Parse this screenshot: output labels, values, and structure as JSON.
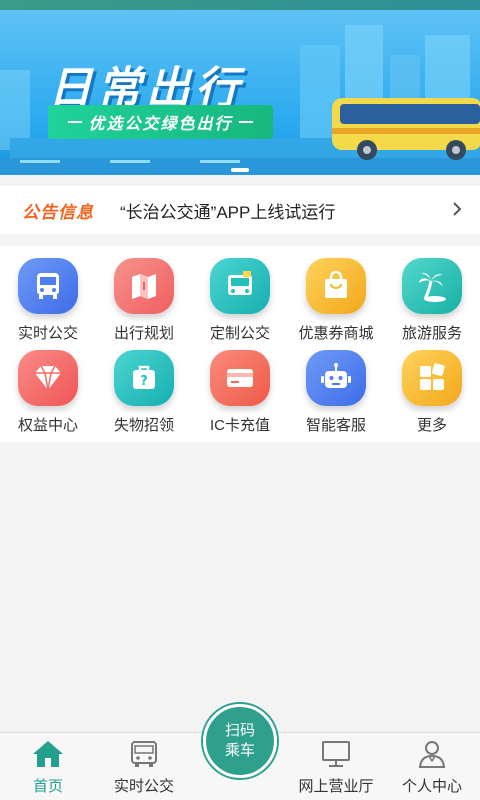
{
  "banner": {
    "title": "日常出行",
    "subtitle": "优选公交绿色出行"
  },
  "notice": {
    "tag": "公告信息",
    "text": "“长治公交通”APP上线试运行"
  },
  "services": [
    {
      "label": "实时公交",
      "icon": "bus-icon",
      "color": "#4f7ef2"
    },
    {
      "label": "出行规划",
      "icon": "map-icon",
      "color": "#f0706a"
    },
    {
      "label": "定制公交",
      "icon": "custom-bus-icon",
      "color": "#22c1bd"
    },
    {
      "label": "优惠券商城",
      "icon": "shopping-bag-icon",
      "color": "#f5b728"
    },
    {
      "label": "旅游服务",
      "icon": "palm-tree-icon",
      "color": "#2cc6b9"
    },
    {
      "label": "权益中心",
      "icon": "diamond-icon",
      "color": "#f36a6a"
    },
    {
      "label": "失物招领",
      "icon": "luggage-icon",
      "color": "#22c1bd"
    },
    {
      "label": "IC卡充值",
      "icon": "card-icon",
      "color": "#f36a5a"
    },
    {
      "label": "智能客服",
      "icon": "robot-icon",
      "color": "#4f7ef2"
    },
    {
      "label": "更多",
      "icon": "more-grid-icon",
      "color": "#f5b728"
    }
  ],
  "tabs": {
    "home": "首页",
    "realtime": "实时公交",
    "scan_line1": "扫码",
    "scan_line2": "乘车",
    "hall": "网上营业厅",
    "profile": "个人中心"
  },
  "colors": {
    "accent": "#239f8d",
    "notice_tag": "#f2641f"
  }
}
